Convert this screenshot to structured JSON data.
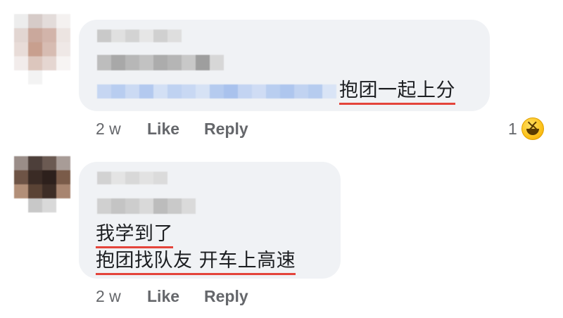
{
  "comments": [
    {
      "text": "抱团一起上分",
      "time": "2 w",
      "like_label": "Like",
      "reply_label": "Reply",
      "reaction": {
        "count": "1",
        "icon": "laughing-emoji-icon"
      }
    },
    {
      "line1": "我学到了",
      "line2": "抱团找队友 开车上高速",
      "time": "2 w",
      "like_label": "Like",
      "reply_label": "Reply"
    }
  ],
  "colors": {
    "bubble": "#f0f2f5",
    "underline": "#e4443b",
    "meta_text": "#65676b",
    "body_text": "#1c1e21"
  }
}
